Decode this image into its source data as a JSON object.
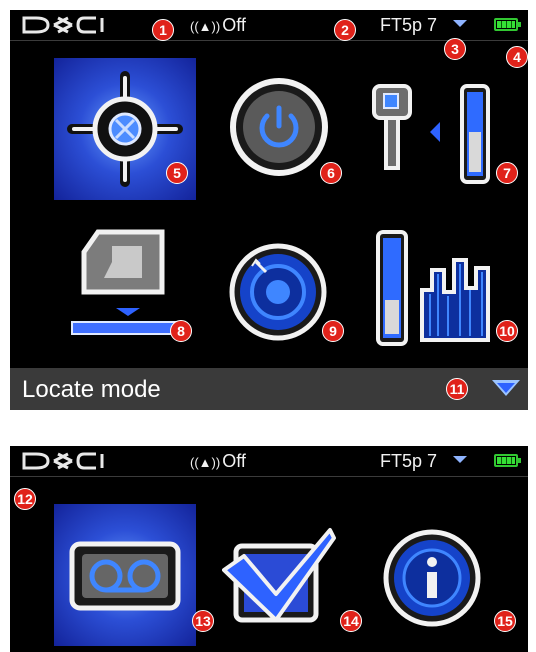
{
  "status": {
    "logo": "DCI",
    "radio_icon": "antenna-icon",
    "radio_text": "Off",
    "frequency": "FT5p 7",
    "battery_icon": "battery-full-icon"
  },
  "main_menu": {
    "mode_label": "Locate mode",
    "items": [
      {
        "icon": "locate-crosshair-icon",
        "selected": true
      },
      {
        "icon": "power-icon",
        "selected": false
      },
      {
        "icon": "transmitter-depth-icon",
        "selected": false
      },
      {
        "icon": "drill-head-calibration-icon",
        "selected": false
      },
      {
        "icon": "settings-dial-icon",
        "selected": false
      },
      {
        "icon": "signal-level-icon",
        "selected": false
      }
    ]
  },
  "callouts": [
    "1",
    "2",
    "3",
    "4",
    "5",
    "6",
    "7",
    "8",
    "9",
    "10",
    "11",
    "12",
    "13",
    "14",
    "15"
  ],
  "colors": {
    "badge": "#e0221a",
    "accent_blue": "#2e62ff",
    "battery_green": "#32c832",
    "bottom_bar": "#3a3a3a"
  },
  "second_menu": {
    "items": [
      {
        "icon": "recorder-tape-icon",
        "selected": true
      },
      {
        "icon": "checkbox-icon",
        "selected": false
      },
      {
        "icon": "info-icon",
        "selected": false
      }
    ]
  }
}
